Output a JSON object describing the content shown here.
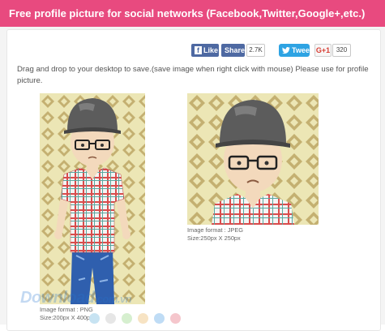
{
  "header": {
    "title": "Free profile picture for social networks (Facebook,Twitter,Google+,etc.)"
  },
  "social": {
    "like_label": "Like",
    "share_label": "Share",
    "share_count": "2.7K",
    "tweet_label": "Tweet",
    "gplus_label": "G+1",
    "gplus_count": "320"
  },
  "hint": "Drag and drop to your desktop to save.(save image when right click with mouse) Please use for profile picture.",
  "images": [
    {
      "format_line": "Image format : PNG",
      "size_line": "Size:200px X 400px"
    },
    {
      "format_line": "Image format : JPEG",
      "size_line": "Size:250px X 250px"
    }
  ],
  "watermark": {
    "main": "Download",
    "suffix": ".com.vn"
  },
  "colors": {
    "header": "#e84a7f",
    "facebook": "#4e69a2",
    "twitter": "#2ea3e3",
    "pattern_bg": "#ece6b5",
    "pattern_diamond": "#c4b071",
    "swatches": [
      "#c7e3f2",
      "#e6e6e6",
      "#d6efcf",
      "#f7e3c3",
      "#bfdcf5",
      "#f5c6cc"
    ]
  }
}
